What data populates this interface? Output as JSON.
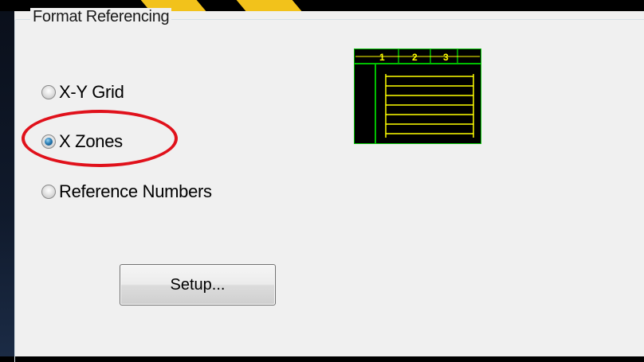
{
  "group": {
    "title": "Format Referencing"
  },
  "radios": [
    {
      "label": "X-Y Grid",
      "checked": false
    },
    {
      "label": "X Zones",
      "checked": true
    },
    {
      "label": "Reference Numbers",
      "checked": false
    }
  ],
  "setup_button": {
    "label": "Setup..."
  },
  "preview": {
    "zones": [
      "1",
      "2",
      "3"
    ],
    "line_color": "#ffff00",
    "border_color": "#00c000",
    "background": "#000000"
  },
  "colors": {
    "highlight": "#e0111b",
    "dialog_bg": "#f0f0f0",
    "accent_yellow": "#f2c21b"
  }
}
